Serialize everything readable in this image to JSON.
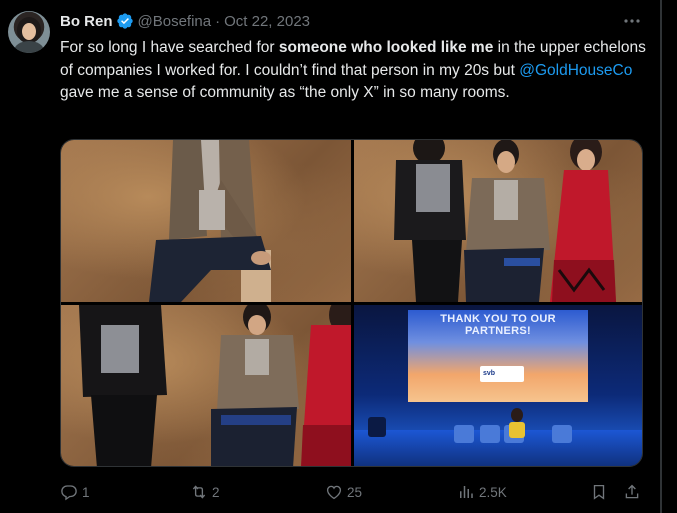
{
  "tweet": {
    "author_name": "Bo Ren",
    "handle": "@Bosefina",
    "separator": "·",
    "date": "Oct 22, 2023",
    "text_parts": {
      "p1": "For so long I have searched for ",
      "bold": "someone who looked like me",
      "p2": " in the upper echelons of companies I worked for. I couldn’t find that person in my 20s but ",
      "mention": "@GoldHouseCo",
      "p3": " gave me a sense of community as “the only X” in so many rooms."
    }
  },
  "media": {
    "slide_title": "THANK YOU TO OUR PARTNERS!",
    "slide_logo": "svb"
  },
  "actions": {
    "replies": "1",
    "reposts": "2",
    "likes": "25",
    "views": "2.5K"
  },
  "icons": [
    "more-icon",
    "verified-icon",
    "reply-icon",
    "repost-icon",
    "like-icon",
    "views-icon",
    "bookmark-icon",
    "share-icon"
  ],
  "colors": {
    "background": "#000000",
    "text": "#e7e9ea",
    "muted": "#71767b",
    "link": "#1d9bf0",
    "verified": "#1d9bf0"
  }
}
